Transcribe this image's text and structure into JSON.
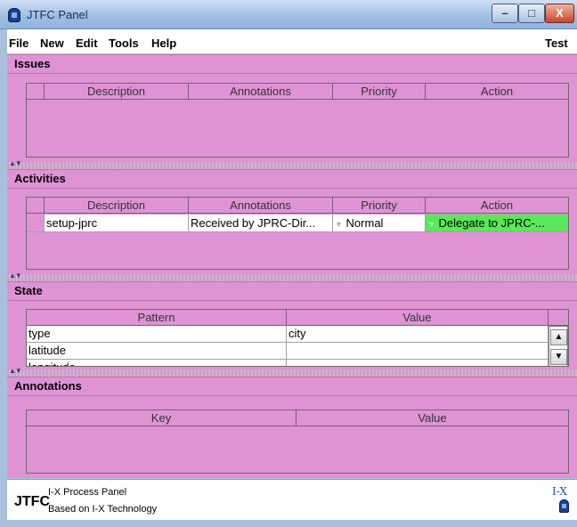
{
  "window": {
    "title": "JTFC Panel"
  },
  "menu": {
    "items": [
      "File",
      "New",
      "Edit",
      "Tools",
      "Help"
    ],
    "right_label": "Test"
  },
  "issues": {
    "title": "Issues",
    "columns": [
      "Description",
      "Annotations",
      "Priority",
      "Action"
    ],
    "rows": []
  },
  "activities": {
    "title": "Activities",
    "columns": [
      "Description",
      "Annotations",
      "Priority",
      "Action"
    ],
    "rows": [
      {
        "description": "setup-jprc",
        "annotations": "Received by JPRC-Dir...",
        "priority": "Normal",
        "action": "Delegate to JPRC-..."
      }
    ],
    "action_color": "#58e858"
  },
  "state": {
    "title": "State",
    "columns": [
      "Pattern",
      "Value"
    ],
    "rows": [
      {
        "pattern": "type",
        "value": "city"
      },
      {
        "pattern": "latitude",
        "value": ""
      },
      {
        "pattern": "longitude",
        "value": ""
      }
    ]
  },
  "annotations": {
    "title": "Annotations",
    "columns": [
      "Key",
      "Value"
    ],
    "rows": []
  },
  "footer": {
    "brand": "JTFC",
    "line1": "I-X Process Panel",
    "line2": "Based on I-X Technology",
    "logo_text": "I-X"
  },
  "colors": {
    "panel_bg": "#df93d5",
    "titlebar": "#9fbfe4"
  }
}
